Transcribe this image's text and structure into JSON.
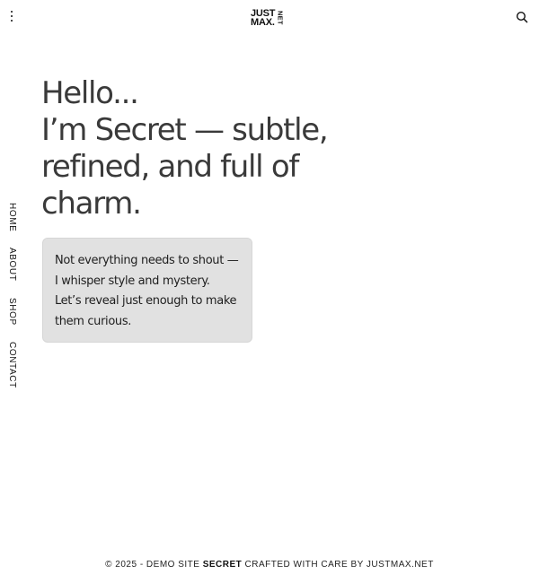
{
  "header": {
    "logo_line1": "JUST",
    "logo_line2": "MAX.",
    "logo_suffix": "NET",
    "menu_icon": "more-vertical-icon",
    "search_icon": "search-icon"
  },
  "side_nav": {
    "items": [
      {
        "label": "HOME"
      },
      {
        "label": "ABOUT"
      },
      {
        "label": "SHOP"
      },
      {
        "label": "CONTACT"
      }
    ]
  },
  "hero": {
    "title_lines": [
      "Hello...",
      "I’m Secret — subtle,",
      "refined, and full of",
      "charm."
    ],
    "intro_lines": [
      "Not everything needs to shout —",
      "I whisper style and mystery.",
      "Let’s reveal just enough to make",
      "them curious."
    ]
  },
  "footer": {
    "prefix": "© 2025 - DEMO SITE ",
    "site_name": "SECRET",
    "suffix": " CRAFTED WITH CARE BY JUSTMAX.NET"
  },
  "colors": {
    "background": "#ffffff",
    "text": "#111111",
    "heading": "#3a3a3a",
    "card_bg": "#e1e1e1"
  }
}
